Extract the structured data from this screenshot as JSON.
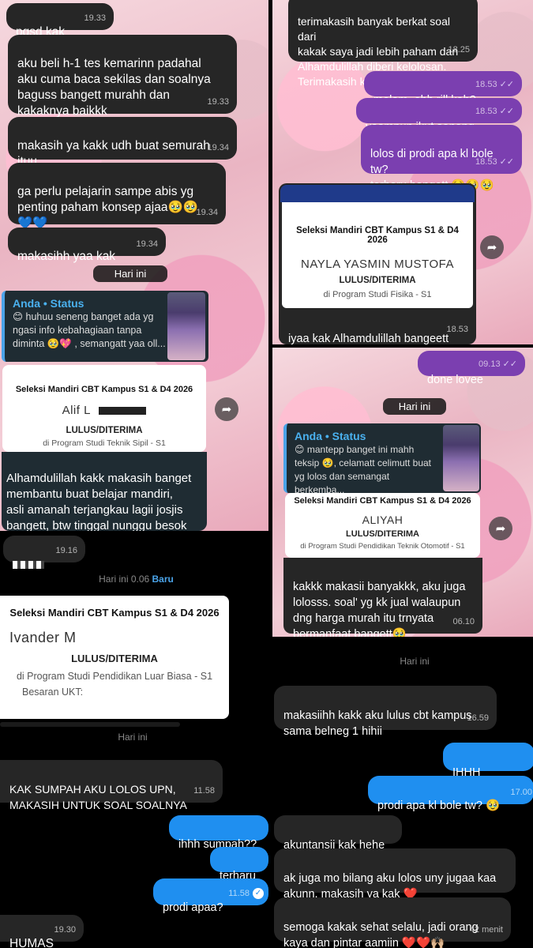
{
  "p1": {
    "m1": {
      "text": "pgsd kak",
      "time": "19.33"
    },
    "m2": {
      "text": "aku beli h-1 tes kemarinn padahal\naku cuma baca sekilas dan soalnya\nbaguss bangett murahh dan\nkakaknya baikkk",
      "time": "19.33"
    },
    "m3": {
      "text": "makasih ya kakk udh buat semurah\nituu",
      "time": "19.34"
    },
    "m4": {
      "text": "ga perlu pelajarin sampe abis yg\npenting paham konsep ajaa🥹🥹\n💙💙",
      "time": "19.34"
    },
    "m5": {
      "text": "makasihh yaa kak",
      "time": "19.34"
    },
    "divider": "Hari ini",
    "status": {
      "head": "Anda • Status",
      "text": "😊 huhuu seneng banget ada yg\nngasi info kebahagiaan tanpa\ndiminta 🥹💖 , semangatt yaa oll..."
    },
    "card": {
      "title": "Seleksi Mandiri CBT Kampus S1 & D4 2026",
      "name": "Alif L",
      "status": "LULUS/DITERIMA",
      "prodi": "di Program Studi Teknik Sipil - S1"
    },
    "m6": {
      "text": "Alhamdulillah kakk makasih banget\nmembantu buat belajar mandiri,\nasli amanah terjangkau lagii josjis\nbangett, btw tinggal nunggu besok\nhasil upn wkwk"
    }
  },
  "p2": {
    "m1": {
      "text": "terimakasih banyak berkat soal dari\nkakak saya jadi lebih paham dan\nAlhamdulillah diberi kelolosan.\nTerimakasih kak",
      "time": "18.25"
    },
    "o1": {
      "text": "malam, ehh rill kah?",
      "time": "18.53"
    },
    "o2": {
      "text": "yaampun ikut seneng",
      "time": "18.53"
    },
    "o3": {
      "text": "lolos di prodi apa kl bole tw?\nterharu bangett 🥹🥹🥹",
      "time": "18.53"
    },
    "card": {
      "title": "Seleksi Mandiri CBT Kampus S1 & D4\n2026",
      "name": "NAYLA YASMIN MUSTOFA",
      "status": "LULUS/DITERIMA",
      "prodi": "di Program Studi Fisika - S1"
    },
    "m2": {
      "text": "iyaa kak Alhamdulillah bangeett",
      "time": "18.53"
    },
    "o4": {
      "text": "done lovee",
      "time": "09.13"
    }
  },
  "p4": {
    "divider": "Hari ini",
    "status": {
      "head": "Anda • Status",
      "text": "😊 mantepp banget ini mahh\nteksip 🥹, celamatt celimutt buat\nyg lolos dan semangat berkemba..."
    },
    "card": {
      "title": "Seleksi Mandiri CBT Kampus S1 & D4 2026",
      "name": "ALIYAH",
      "status": "LULUS/DITERIMA",
      "prodi": "di Program Studi Pendidikan Teknik Otomotif - S1"
    },
    "m1": {
      "text": "kakkk makasii banyakkk, aku juga\nlolosss. soal' yg kk jual walaupun\ndng harga murah itu trnyata\nbermanfaat bangett🥹",
      "time": "06.10"
    }
  },
  "p3": {
    "top_time": "19.16",
    "divider": "Hari ini 0.06",
    "divider_badge": "Baru",
    "card": {
      "title": "Seleksi Mandiri CBT Kampus S1 & D4 2026",
      "name": "Ivander M",
      "status": "LULUS/DITERIMA",
      "prodi": "di Program Studi Pendidikan Luar Biasa - S1",
      "ukt": "Besaran UKT:"
    },
    "divider2": "Hari ini",
    "m1": {
      "text": "KAK SUMPAH AKU LOLOS UPN,\nMAKASIH UNTUK SOAL SOALNYA",
      "time": "11.58"
    },
    "o1": {
      "text": "ihhh sumpah??"
    },
    "o2": {
      "text": "terharu"
    },
    "o3": {
      "text": "prodi apaa?",
      "time": "11.58"
    },
    "m2": {
      "text": "HUMAS",
      "time": "19.30"
    }
  },
  "p5": {
    "divider": "Hari ini",
    "m1": {
      "text": "makasiihh kakk aku lulus cbt kampus\nsama belneg 1 hihii",
      "time": "16.59"
    },
    "o1": {
      "text": "IHHH SERIUSS"
    },
    "o2": {
      "text": "prodi apa kl bole tw? 🥹",
      "time": "17.00"
    },
    "m2": {
      "text": "akuntansii kak hehe"
    },
    "m3": {
      "text": "ak juga mo bilang aku lolos uny jugaa kaa\nakunn, makasih ya kak ❤️"
    },
    "m4": {
      "text": "semoga kakak sehat selalu, jadi orang\nkaya dan pintar aamiin ❤️❤️🙌🏼",
      "time": "42 menit"
    }
  }
}
